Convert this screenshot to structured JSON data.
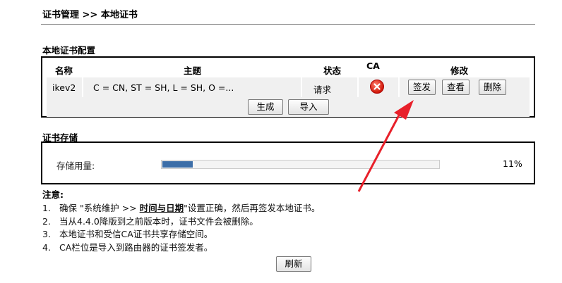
{
  "breadcrumb": "证书管理 >> 本地证书",
  "local_cert": {
    "section_title": "本地证书配置",
    "headers": {
      "name": "名称",
      "subject": "主题",
      "status": "状态",
      "ca": "CA",
      "modify": "修改"
    },
    "rows": [
      {
        "name": "ikev2",
        "subject": "C = CN, ST = SH, L = SH, O =...",
        "status": "请求",
        "ca_icon": "error-x-icon",
        "buttons": {
          "sign": "签发",
          "view": "查看",
          "delete": "删除"
        }
      }
    ],
    "generate_label": "生成",
    "import_label": "导入"
  },
  "storage": {
    "section_title": "证书存储",
    "label": "存储用量:",
    "percent_text": "11%",
    "percent_value": 11
  },
  "notes": {
    "title": "注意:",
    "items": [
      {
        "num": "1.",
        "pre": "确保 \"系统维护 >> ",
        "link": "时间与日期",
        "post": "\"设置正确，然后再签发本地证书。"
      },
      {
        "num": "2.",
        "text": "当从4.4.0降版到之前版本时，证书文件会被删除。"
      },
      {
        "num": "3.",
        "text": "本地证书和受信CA证书共享存储空间。"
      },
      {
        "num": "4.",
        "text": "CA栏位是导入到路由器的证书签发者。"
      }
    ]
  },
  "refresh_label": "刷新",
  "colors": {
    "annotation_arrow": "#e8202a",
    "progress_fill": "#3c6ea8",
    "row_bg": "#f0f0f0"
  }
}
